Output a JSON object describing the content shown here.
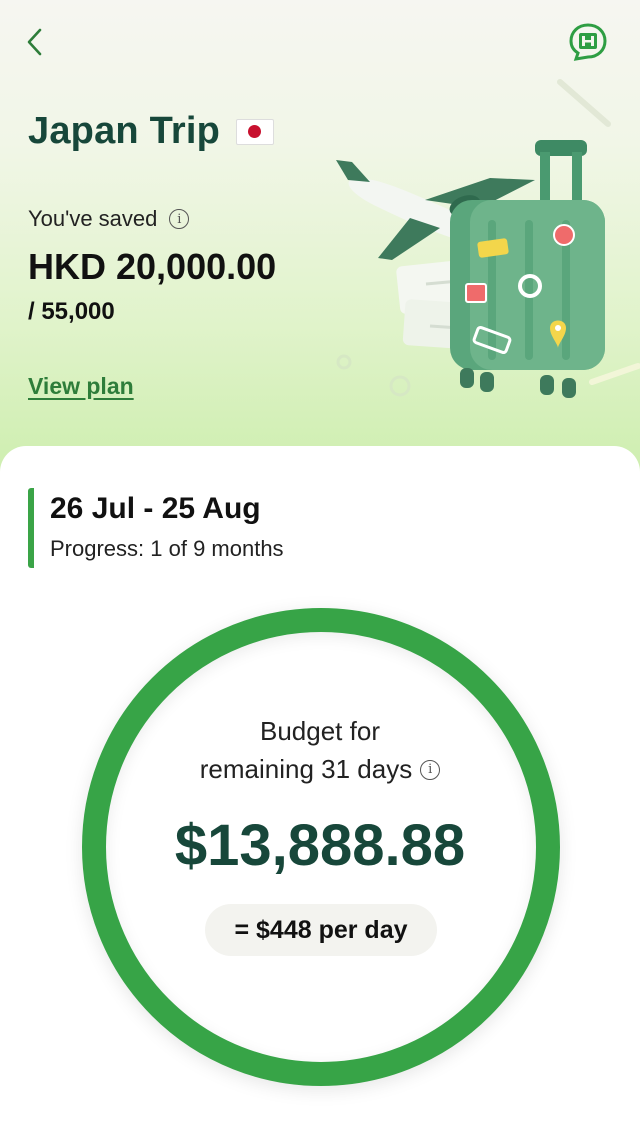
{
  "header": {
    "back_icon": "chevron-left-icon",
    "chat_icon": "chat-icon",
    "accent_color": "#2e7d3a"
  },
  "plan": {
    "title": "Japan Trip",
    "flag_icon": "japan-flag-icon",
    "saved_label": "You've saved",
    "saved_amount": "HKD 20,000.00",
    "target": "/ 55,000",
    "view_plan_label": "View plan"
  },
  "period": {
    "dates": "26 Jul - 25 Aug",
    "progress": "Progress: 1 of 9 months"
  },
  "budget": {
    "label_line1": "Budget for",
    "label_line2": "remaining 31 days",
    "amount": "$13,888.88",
    "per_day": "= $448 per day",
    "ring_color": "#37a447"
  }
}
